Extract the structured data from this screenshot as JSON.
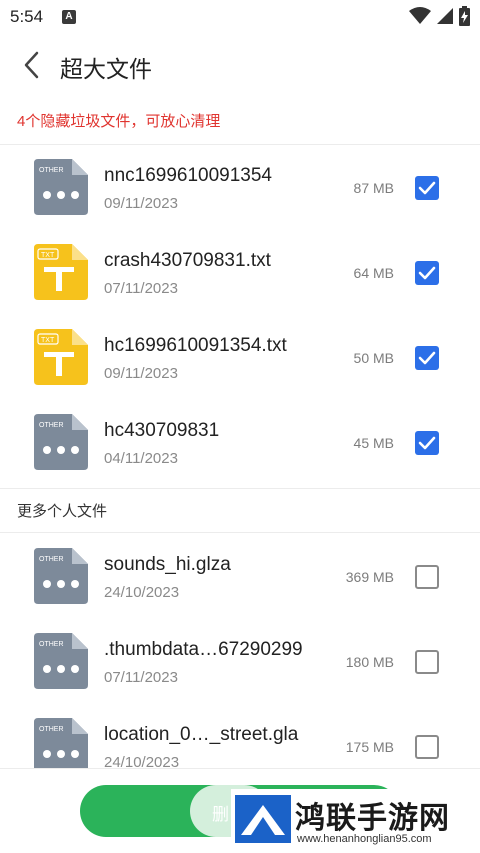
{
  "status_bar": {
    "time": "5:54",
    "notification_icon": "A"
  },
  "header": {
    "title": "超大文件",
    "back_icon": "chevron-left-icon"
  },
  "notice": "4个隐藏垃圾文件，可放心清理",
  "hidden_files": [
    {
      "name": "nnc1699610091354",
      "date": "09/11/2023",
      "size": "87 MB",
      "type": "OTHER",
      "checked": true
    },
    {
      "name": "crash430709831.txt",
      "date": "07/11/2023",
      "size": "64 MB",
      "type": "TXT",
      "checked": true
    },
    {
      "name": "hc1699610091354.txt",
      "date": "09/11/2023",
      "size": "50 MB",
      "type": "TXT",
      "checked": true
    },
    {
      "name": "hc430709831",
      "date": "04/11/2023",
      "size": "45 MB",
      "type": "OTHER",
      "checked": true
    }
  ],
  "more_section_label": "更多个人文件",
  "personal_files": [
    {
      "name": "sounds_hi.glza",
      "date": "24/10/2023",
      "size": "369 MB",
      "type": "OTHER",
      "checked": false
    },
    {
      "name": ".thumbdata…67290299",
      "date": "07/11/2023",
      "size": "180 MB",
      "type": "OTHER",
      "checked": false
    },
    {
      "name": "location_0…_street.gla",
      "date": "24/10/2023",
      "size": "175 MB",
      "type": "OTHER",
      "checked": false
    }
  ],
  "delete_button": {
    "label": "删"
  },
  "watermark": {
    "title": "鸿联手游网",
    "url": "www.henanhonglian95.com"
  },
  "colors": {
    "accent_blue": "#2c6fe8",
    "notice_red": "#e0342f",
    "button_green": "#2bb35a",
    "txt_icon_yellow": "#f6c21c",
    "other_icon_gray": "#7d8a9a"
  }
}
